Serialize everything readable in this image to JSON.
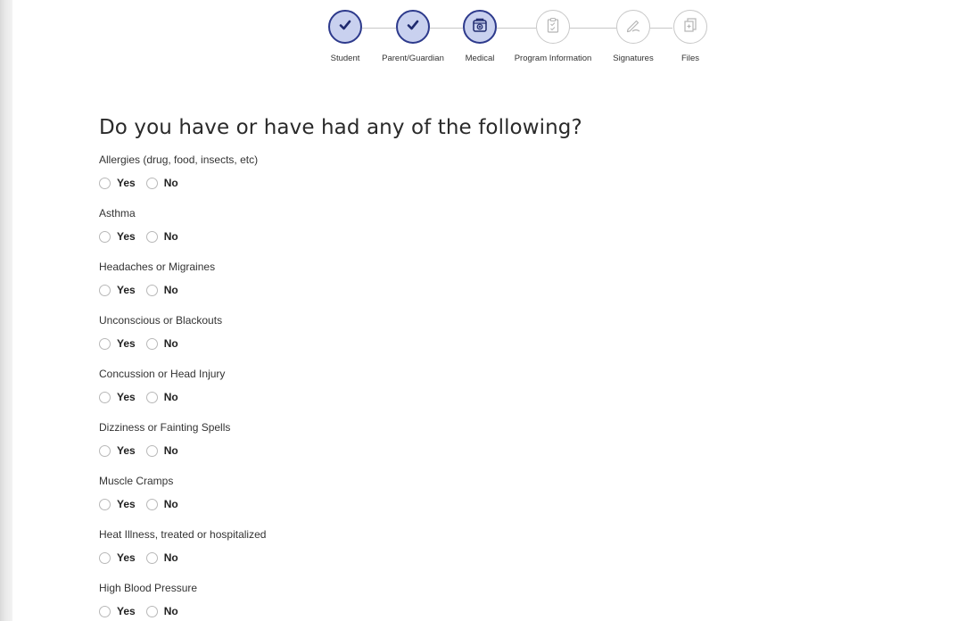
{
  "stepper": {
    "steps": [
      {
        "label": "Student",
        "state": "done",
        "icon": "checkmark-icon"
      },
      {
        "label": "Parent/Guardian",
        "state": "done",
        "icon": "checkmark-icon"
      },
      {
        "label": "Medical",
        "state": "current",
        "icon": "medical-kit-icon"
      },
      {
        "label": "Program Information",
        "state": "todo",
        "icon": "clipboard-icon"
      },
      {
        "label": "Signatures",
        "state": "todo",
        "icon": "signature-pen-icon"
      },
      {
        "label": "Files",
        "state": "todo",
        "icon": "add-file-icon"
      }
    ],
    "colors": {
      "active_border": "#2d3a8c",
      "active_fill": "#c9d1ef",
      "inactive_border": "#c8c8c8"
    }
  },
  "form": {
    "title": "Do you have or have had any of the following?",
    "yes_label": "Yes",
    "no_label": "No",
    "questions": [
      {
        "label": "Allergies (drug, food, insects, etc)"
      },
      {
        "label": "Asthma"
      },
      {
        "label": "Headaches or Migraines"
      },
      {
        "label": "Unconscious or Blackouts"
      },
      {
        "label": "Concussion or Head Injury"
      },
      {
        "label": "Dizziness or Fainting Spells"
      },
      {
        "label": "Muscle Cramps"
      },
      {
        "label": "Heat Illness, treated or hospitalized"
      },
      {
        "label": "High Blood Pressure"
      }
    ]
  }
}
